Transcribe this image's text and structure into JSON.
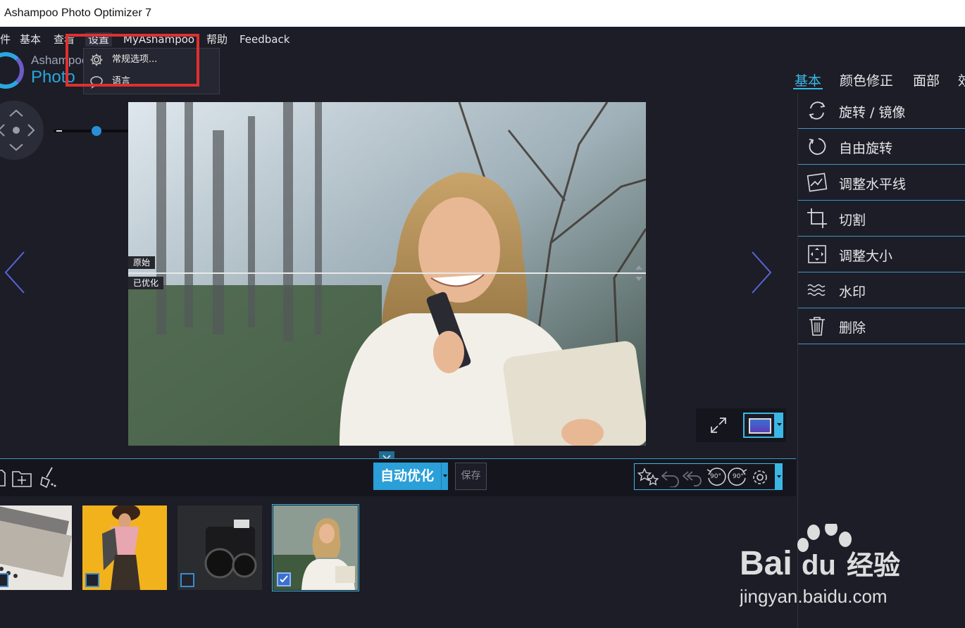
{
  "window": {
    "title": "Ashampoo Photo Optimizer 7"
  },
  "menubar": {
    "items": [
      {
        "label": "件"
      },
      {
        "label": "基本"
      },
      {
        "label": "查看"
      },
      {
        "label": "设置"
      },
      {
        "label": "MyAshampoo"
      },
      {
        "label": "帮助"
      },
      {
        "label": "Feedback"
      }
    ],
    "active_index": 3
  },
  "dropdown": {
    "items": [
      {
        "label": "常规选项...",
        "icon": "gear-icon"
      },
      {
        "label": "语言",
        "icon": "speech-bubble-icon"
      }
    ]
  },
  "logo": {
    "line1": "Ashampoo",
    "line2": "Photo"
  },
  "photo": {
    "label_original": "原始",
    "label_optimized": "已优化"
  },
  "right_tabs": [
    {
      "label": "基本",
      "active": true
    },
    {
      "label": "颜色修正",
      "active": false
    },
    {
      "label": "面部",
      "active": false
    },
    {
      "label": "效",
      "active": false
    }
  ],
  "tools": [
    {
      "label": "旋转 / 镜像",
      "icon": "rotate-mirror-icon"
    },
    {
      "label": "自由旋转",
      "icon": "free-rotate-icon"
    },
    {
      "label": "调整水平线",
      "icon": "horizon-icon"
    },
    {
      "label": "切割",
      "icon": "crop-icon"
    },
    {
      "label": "调整大小",
      "icon": "resize-icon"
    },
    {
      "label": "水印",
      "icon": "watermark-icon"
    },
    {
      "label": "删除",
      "icon": "trash-icon"
    }
  ],
  "toolbar": {
    "auto_optimize": "自动优化",
    "save": "保存",
    "rotate_left_label": "90°",
    "rotate_right_label": "90°"
  },
  "colors": {
    "accent": "#3bb7e6",
    "highlight": "#e0302f",
    "bg": "#1c1d26"
  },
  "filmstrip": {
    "thumb_count": 4,
    "selected_index": 3
  },
  "watermark": {
    "logo": "Bai du 经验",
    "url": "jingyan.baidu.com"
  }
}
